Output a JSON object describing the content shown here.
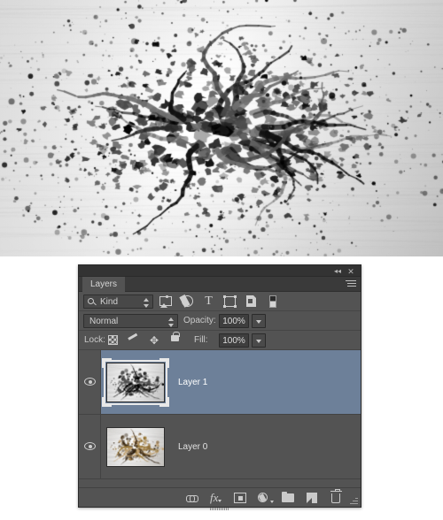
{
  "artwork": {
    "description": "grayscale ink splatter on light brushed background",
    "background_color": "#f1f1f1",
    "splatter_color": "#1a1a1a"
  },
  "panel": {
    "titlebar": {
      "collapse_icon": "collapse-to-icons",
      "collapse_glyph": "◂◂",
      "close_icon": "close-panel",
      "close_glyph": "✕"
    },
    "tab": {
      "label": "Layers",
      "menu_icon": "panel-menu-icon"
    },
    "filter_row": {
      "kind_select_value": "Kind",
      "search_icon": "search-icon",
      "filter_icons": [
        "pixel-layer-filter-icon",
        "adjustment-layer-filter-icon",
        "type-layer-filter-icon",
        "shape-layer-filter-icon",
        "smart-object-filter-icon",
        "layer-mask-filter-icon"
      ],
      "type_glyph": "T"
    },
    "blend_row": {
      "blend_mode": "Normal",
      "opacity_label": "Opacity:",
      "opacity_value": "100%"
    },
    "lock_row": {
      "lock_label": "Lock:",
      "lock_icons": [
        "lock-transparent-pixels-icon",
        "lock-image-pixels-icon",
        "lock-position-icon",
        "lock-all-icon"
      ],
      "move_glyph": "✥",
      "fill_label": "Fill:",
      "fill_value": "100%"
    },
    "layers": [
      {
        "name": "Layer 1",
        "visible": true,
        "selected": true,
        "thumbnail_style": "grayscale-splatter",
        "eye_icon": "eye-icon"
      },
      {
        "name": "Layer 0",
        "visible": true,
        "selected": false,
        "thumbnail_style": "sepia-splatter",
        "eye_icon": "eye-icon"
      }
    ],
    "footer_icons": [
      "link-layers-icon",
      "add-layer-style-icon",
      "add-layer-mask-icon",
      "new-adjustment-layer-icon",
      "new-group-icon",
      "new-layer-icon",
      "delete-layer-icon"
    ],
    "fx_glyph": "fx",
    "resize_grip": "resize-grip"
  },
  "colors": {
    "panel_bg": "#535353",
    "panel_header": "#3a3a3a",
    "selected_layer": "#6d8099",
    "text": "#d2d2d2",
    "field_bg": "#3e3e3e"
  }
}
